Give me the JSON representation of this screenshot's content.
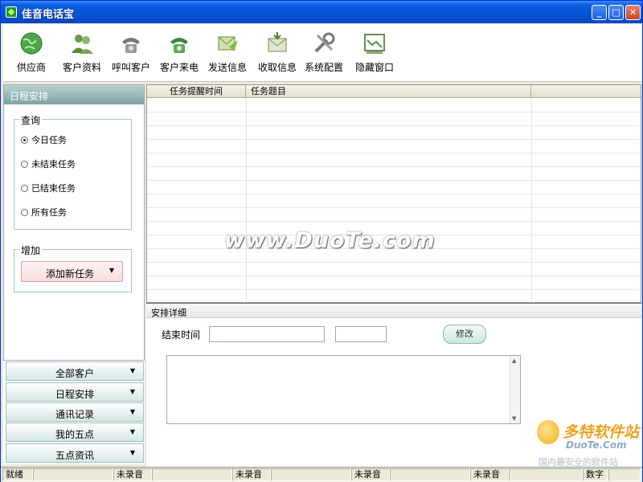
{
  "window": {
    "title": "佳音电话宝",
    "min": "_",
    "max": "□",
    "close": "✕"
  },
  "toolbar": {
    "items": [
      {
        "label": "供应商",
        "icon": "globe-icon"
      },
      {
        "label": "客户资料",
        "icon": "users-icon"
      },
      {
        "label": "呼叫客户",
        "icon": "phone-out-icon"
      },
      {
        "label": "客户来电",
        "icon": "phone-in-icon"
      },
      {
        "label": "发送信息",
        "icon": "send-message-icon"
      },
      {
        "label": "收取信息",
        "icon": "receive-message-icon"
      },
      {
        "label": "系统配置",
        "icon": "tools-icon"
      },
      {
        "label": "隐藏窗口",
        "icon": "hide-window-icon"
      }
    ]
  },
  "schedule_panel": {
    "title": "日程安排",
    "query": {
      "title": "查询",
      "options": [
        "今日任务",
        "未结束任务",
        "已结束任务",
        "所有任务"
      ],
      "selected": 0
    },
    "add": {
      "title": "增加",
      "button": "添加新任务",
      "arrow": "▼"
    }
  },
  "nav": {
    "items": [
      "全部客户",
      "日程安排",
      "通讯记录",
      "我的五点",
      "五点资讯"
    ],
    "arrow": "▼"
  },
  "task_grid": {
    "columns": [
      "任务提醒时间",
      "任务题目"
    ]
  },
  "watermark": "www.DuoTe.com",
  "detail": {
    "title": "安排详细",
    "end_time_label": "结束时间",
    "modify_button": "修改"
  },
  "logo": {
    "brand": "多特软件站",
    "site": "DuoTe.Com",
    "tagline": "国内最安全的软件站"
  },
  "status": {
    "ready": "就绪",
    "not_recording": "未录音",
    "numlock": "数字"
  },
  "colors": {
    "titlebar": "#0553d6",
    "panel_header": "#7ea2a4",
    "toolbar_bg": "#ffffff"
  }
}
